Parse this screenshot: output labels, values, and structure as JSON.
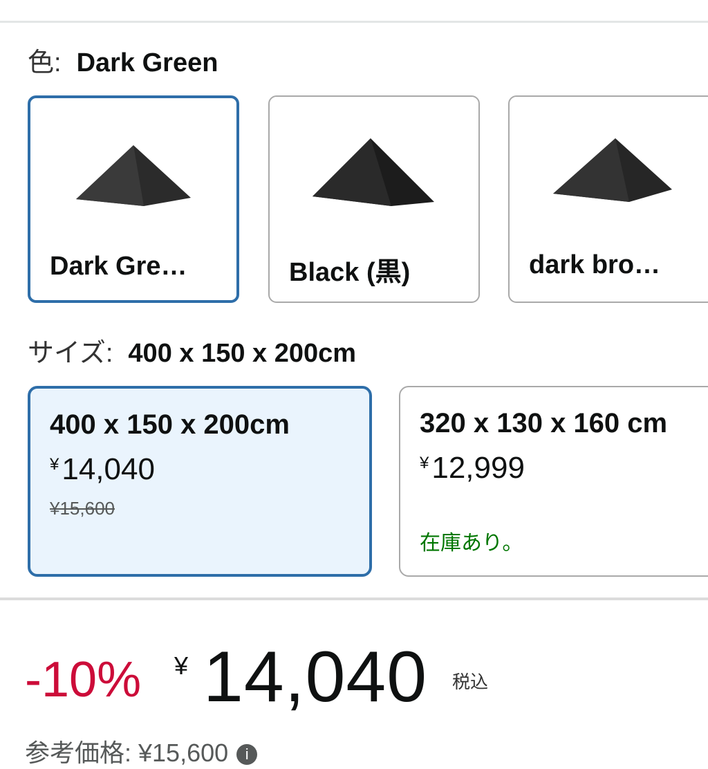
{
  "color_selector": {
    "label": "色:",
    "selected_value": "Dark Green",
    "options": [
      {
        "name": "Dark Gre…",
        "selected": true
      },
      {
        "name": "Black (黒)",
        "selected": false
      },
      {
        "name": "dark bro…",
        "selected": false
      }
    ]
  },
  "size_selector": {
    "label": "サイズ:",
    "selected_value": "400 x 150 x 200cm",
    "options": [
      {
        "dims": "400 x 150 x 200cm",
        "yen": "¥",
        "price": "14,040",
        "list_price": "¥15,600",
        "stock": "",
        "selected": true
      },
      {
        "dims": "320 x 130 x 160 cm",
        "yen": "¥",
        "price": "12,999",
        "list_price": "",
        "stock": "在庫あり。",
        "selected": false
      }
    ]
  },
  "price_block": {
    "discount": "-10%",
    "yen": "¥",
    "amount": "14,040",
    "tax_label": "税込"
  },
  "reference_price": {
    "label": "参考価格: ¥15,600",
    "info_icon": "info-icon"
  },
  "colors": {
    "selected_border": "#2e6ea9",
    "selected_bg": "#eaf4fd",
    "discount": "#cc0c39",
    "in_stock": "#007600"
  }
}
